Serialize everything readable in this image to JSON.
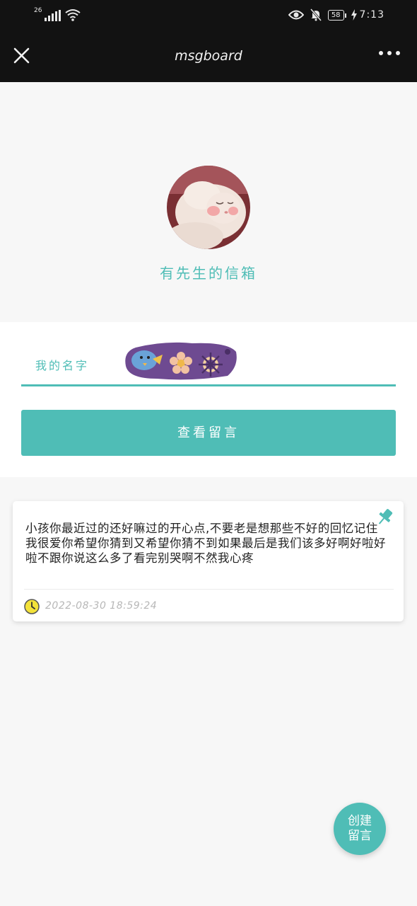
{
  "status_bar": {
    "network": "26",
    "battery": "58",
    "time": "7:13"
  },
  "app_bar": {
    "title": "msgboard"
  },
  "header": {
    "board_title": "有先生的信箱"
  },
  "form": {
    "name_label": "我的名字",
    "view_button_label": "查看留言"
  },
  "message": {
    "text": "小孩你最近过的还好嘛过的开心点,不要老是想那些不好的回忆记住我很爱你希望你猜到又希望你猜不到如果最后是我们该多好啊好啦好啦不跟你说这么多了看完别哭啊不然我心疼",
    "timestamp": "2022-08-30 18:59:24"
  },
  "fab": {
    "line1": "创建",
    "line2": "留言"
  },
  "colors": {
    "accent": "#4fbdb6",
    "bar_background": "#121212",
    "page_background": "#f7f7f7"
  },
  "icons": [
    "close-icon",
    "more-icon",
    "pin-icon",
    "clock-icon",
    "eye-icon",
    "bell-off-icon",
    "wifi-icon",
    "charging-icon"
  ]
}
